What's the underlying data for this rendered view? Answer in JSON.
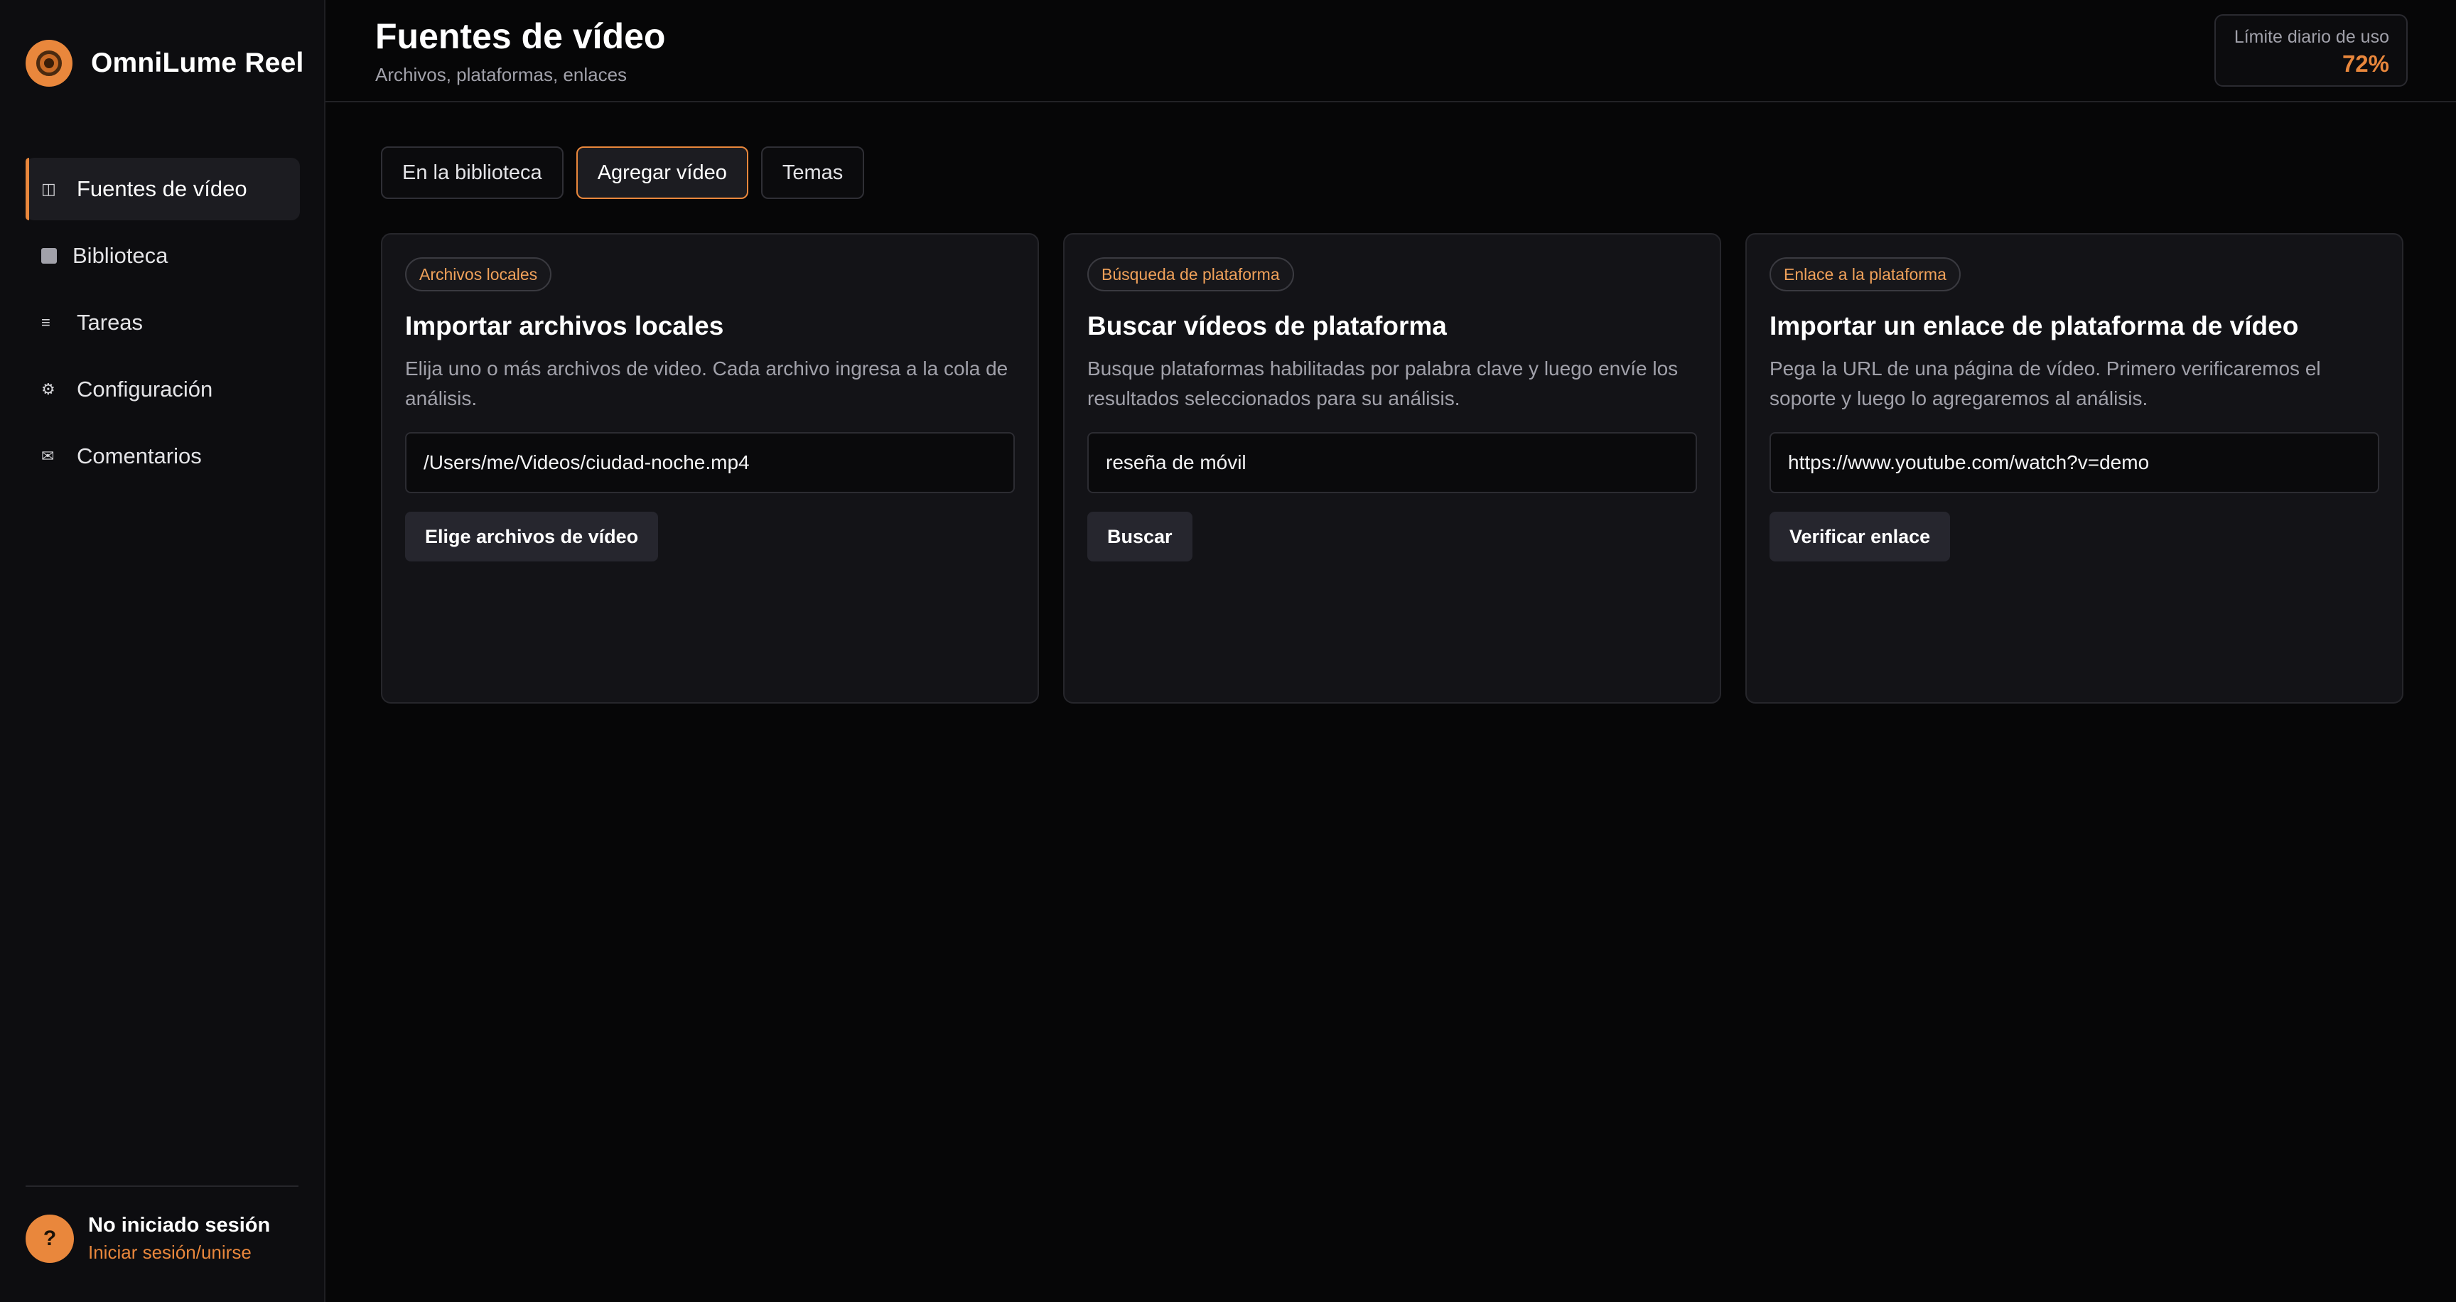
{
  "app": {
    "name": "OmniLume Reel"
  },
  "sidebar": {
    "items": [
      {
        "label": "Fuentes de vídeo",
        "icon": "panel-icon",
        "active": true
      },
      {
        "label": "Biblioteca",
        "icon": "square-icon",
        "active": false
      },
      {
        "label": "Tareas",
        "icon": "list-icon",
        "active": false
      },
      {
        "label": "Configuración",
        "icon": "gear-icon",
        "active": false
      },
      {
        "label": "Comentarios",
        "icon": "mail-icon",
        "active": false
      }
    ],
    "user": {
      "avatar": "?",
      "status": "No iniciado sesión",
      "link": "Iniciar sesión/unirse"
    }
  },
  "header": {
    "title": "Fuentes de vídeo",
    "subtitle": "Archivos, plataformas, enlaces",
    "usage_label": "Límite diario de uso",
    "usage_value": "72%"
  },
  "tabs": [
    {
      "label": "En la biblioteca",
      "active": false
    },
    {
      "label": "Agregar vídeo",
      "active": true
    },
    {
      "label": "Temas",
      "active": false
    }
  ],
  "cards": [
    {
      "badge": "Archivos locales",
      "title": "Importar archivos locales",
      "description": "Elija uno o más archivos de video. Cada archivo ingresa a la cola de análisis.",
      "input_value": "/Users/me/Videos/ciudad-noche.mp4",
      "button": "Elige archivos de vídeo"
    },
    {
      "badge": "Búsqueda de plataforma",
      "title": "Buscar vídeos de plataforma",
      "description": "Busque plataformas habilitadas por palabra clave y luego envíe los resultados seleccionados para su análisis.",
      "input_value": "reseña de móvil",
      "button": "Buscar"
    },
    {
      "badge": "Enlace a la plataforma",
      "title": "Importar un enlace de plataforma de vídeo",
      "description": "Pega la URL de una página de vídeo. Primero verificaremos el soporte y luego lo agregaremos al análisis.",
      "input_value": "https://www.youtube.com/watch?v=demo",
      "button": "Verificar enlace"
    }
  ],
  "colors": {
    "accent": "#e9873c",
    "background": "#060607",
    "sidebar": "#0d0d10",
    "card": "#131317"
  }
}
